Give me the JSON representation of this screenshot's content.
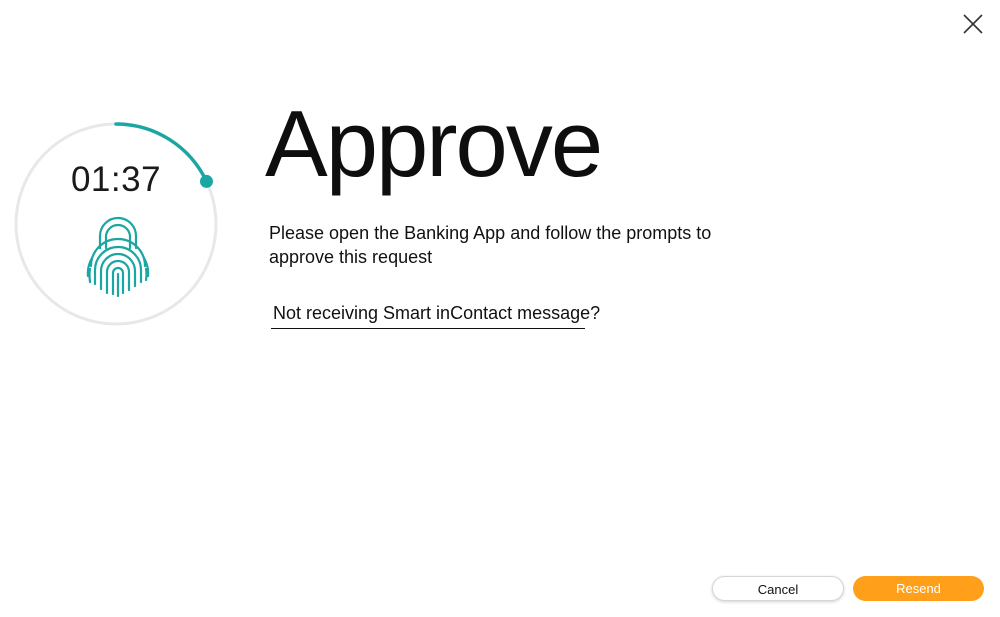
{
  "dialog": {
    "title": "Approve",
    "instructions": "Please open the Banking App and follow the prompts to approve this request",
    "help_link": "Not receiving Smart inContact message?"
  },
  "timer": {
    "countdown": "01:37",
    "progress_fraction": 0.18,
    "ring_color": "#1aa6a3",
    "track_color": "#e8e8e8"
  },
  "icons": {
    "close": "close-icon",
    "fingerprint_lock": "fingerprint-lock-icon"
  },
  "buttons": {
    "cancel": "Cancel",
    "resend": "Resend"
  },
  "colors": {
    "accent_orange": "#ff9f1a",
    "teal": "#1aa6a3"
  }
}
